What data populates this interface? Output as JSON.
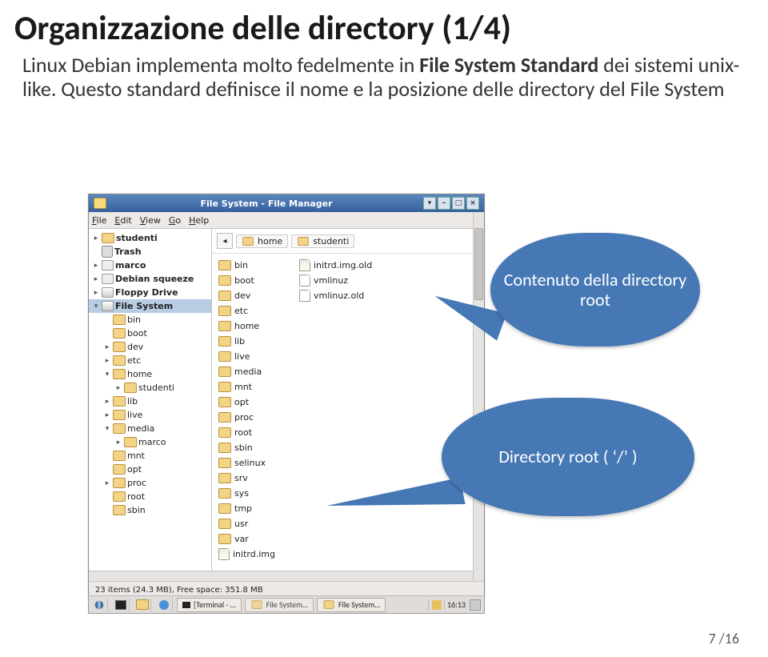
{
  "slide": {
    "title": "Organizzazione delle directory (1/4)",
    "bodyHtmlPrefix": "Linux Debian implementa molto fedelmente in ",
    "fsName": "File System Standard",
    "bodyHtmlSuffix": " dei sistemi unix-like. Questo standard definisce il nome e la posizione delle directory del File System",
    "pagenum": "7 /16"
  },
  "bubbles": {
    "b1": "Contenuto della directory root",
    "b2": "Directory root ( ‘/’ )"
  },
  "fm": {
    "title": "File System - File Manager",
    "menus": [
      "File",
      "Edit",
      "View",
      "Go",
      "Help"
    ],
    "status": "23 items (24.3 MB), Free space: 351.8 MB",
    "pathbar": {
      "crumb1": "home",
      "crumb2": "studenti"
    },
    "tree": [
      {
        "icon": "folder",
        "label": "studenti",
        "tri": "right",
        "indent": 0,
        "bold": true
      },
      {
        "icon": "trash",
        "label": "Trash",
        "tri": "blank",
        "indent": 0,
        "bold": true
      },
      {
        "icon": "disk",
        "label": "marco",
        "tri": "right",
        "indent": 0,
        "bold": true
      },
      {
        "icon": "disk",
        "label": "Debian squeeze",
        "tri": "right",
        "indent": 0,
        "bold": true
      },
      {
        "icon": "drive",
        "label": "Floppy Drive",
        "tri": "right",
        "indent": 0,
        "bold": true
      },
      {
        "icon": "drive",
        "label": "File System",
        "tri": "down",
        "indent": 0,
        "bold": true,
        "sel": true
      },
      {
        "icon": "folder",
        "label": "bin",
        "tri": "blank",
        "indent": 1
      },
      {
        "icon": "folder",
        "label": "boot",
        "tri": "blank",
        "indent": 1
      },
      {
        "icon": "folder",
        "label": "dev",
        "tri": "right",
        "indent": 1
      },
      {
        "icon": "folder",
        "label": "etc",
        "tri": "right",
        "indent": 1
      },
      {
        "icon": "folder",
        "label": "home",
        "tri": "down",
        "indent": 1
      },
      {
        "icon": "folder",
        "label": "studenti",
        "tri": "right",
        "indent": 2
      },
      {
        "icon": "folder",
        "label": "lib",
        "tri": "right",
        "indent": 1
      },
      {
        "icon": "folder",
        "label": "live",
        "tri": "right",
        "indent": 1
      },
      {
        "icon": "folder",
        "label": "media",
        "tri": "down",
        "indent": 1
      },
      {
        "icon": "folder",
        "label": "marco",
        "tri": "right",
        "indent": 2
      },
      {
        "icon": "folder",
        "label": "mnt",
        "tri": "blank",
        "indent": 1
      },
      {
        "icon": "folder",
        "label": "opt",
        "tri": "blank",
        "indent": 1
      },
      {
        "icon": "folder",
        "label": "proc",
        "tri": "right",
        "indent": 1
      },
      {
        "icon": "folder",
        "label": "root",
        "tri": "blank",
        "indent": 1
      },
      {
        "icon": "folder",
        "label": "sbin",
        "tri": "blank",
        "indent": 1
      }
    ],
    "content_col1": [
      {
        "icon": "folder",
        "label": "bin"
      },
      {
        "icon": "folder",
        "label": "boot"
      },
      {
        "icon": "folder",
        "label": "dev"
      },
      {
        "icon": "folder",
        "label": "etc"
      },
      {
        "icon": "folder",
        "label": "home"
      },
      {
        "icon": "folder",
        "label": "lib"
      },
      {
        "icon": "folder",
        "label": "live"
      },
      {
        "icon": "folder",
        "label": "media"
      },
      {
        "icon": "folder",
        "label": "mnt"
      },
      {
        "icon": "folder",
        "label": "opt"
      },
      {
        "icon": "folder",
        "label": "proc"
      },
      {
        "icon": "folder",
        "label": "root"
      },
      {
        "icon": "folder",
        "label": "sbin"
      },
      {
        "icon": "folder",
        "label": "selinux"
      },
      {
        "icon": "folder",
        "label": "srv"
      },
      {
        "icon": "folder",
        "label": "sys"
      },
      {
        "icon": "folder",
        "label": "tmp"
      },
      {
        "icon": "folder",
        "label": "usr"
      },
      {
        "icon": "folder",
        "label": "var"
      },
      {
        "icon": "fileimg",
        "label": "initrd.img"
      }
    ],
    "content_col2": [
      {
        "icon": "fileimg",
        "label": "initrd.img.old"
      },
      {
        "icon": "file",
        "label": "vmlinuz"
      },
      {
        "icon": "file",
        "label": "vmlinuz.old"
      }
    ]
  },
  "taskbar": {
    "task1": "[Terminal - …",
    "task2": "File System…",
    "task3": "File System…",
    "clock": "16:13"
  }
}
